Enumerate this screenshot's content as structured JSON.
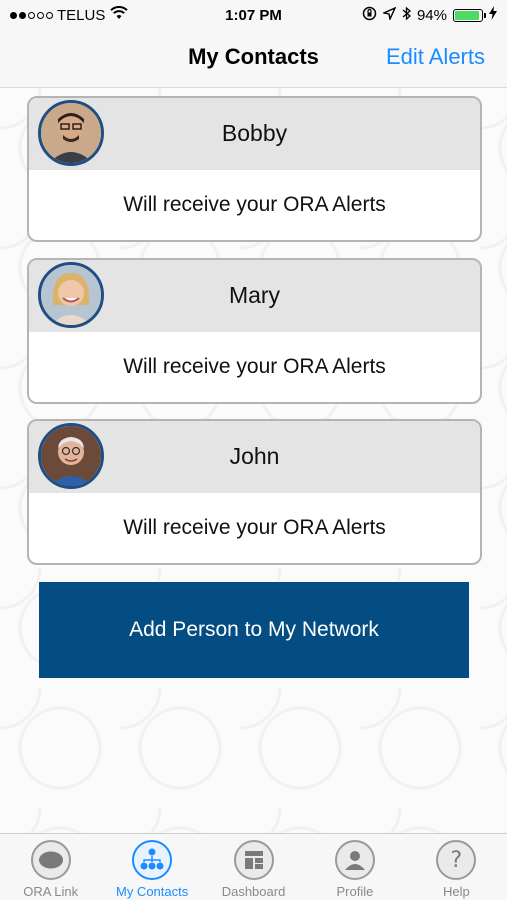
{
  "status_bar": {
    "carrier": "TELUS",
    "time": "1:07 PM",
    "battery": "94%",
    "battery_level": 0.94,
    "signal_bars_filled": 2,
    "signal_bars_total": 5
  },
  "nav": {
    "title": "My Contacts",
    "action": "Edit Alerts"
  },
  "contacts": [
    {
      "name": "Bobby",
      "status": "Will receive your ORA Alerts",
      "avatar_icon": "person-photo-icon"
    },
    {
      "name": "Mary",
      "status": "Will receive your ORA Alerts",
      "avatar_icon": "person-photo-icon"
    },
    {
      "name": "John",
      "status": "Will receive your ORA Alerts",
      "avatar_icon": "person-photo-icon"
    }
  ],
  "add_button": {
    "label": "Add Person to My Network"
  },
  "tabs": [
    {
      "label": "ORA Link",
      "icon": "speech-bubble-icon",
      "active": false
    },
    {
      "label": "My Contacts",
      "icon": "network-icon",
      "active": true
    },
    {
      "label": "Dashboard",
      "icon": "dashboard-grid-icon",
      "active": false
    },
    {
      "label": "Profile",
      "icon": "person-icon",
      "active": false
    },
    {
      "label": "Help",
      "icon": "question-mark-icon",
      "active": false
    }
  ],
  "colors": {
    "accent": "#1a8cff",
    "button_bg": "#044d82",
    "avatar_border": "#1f4f82",
    "battery_fill": "#4cd964"
  }
}
